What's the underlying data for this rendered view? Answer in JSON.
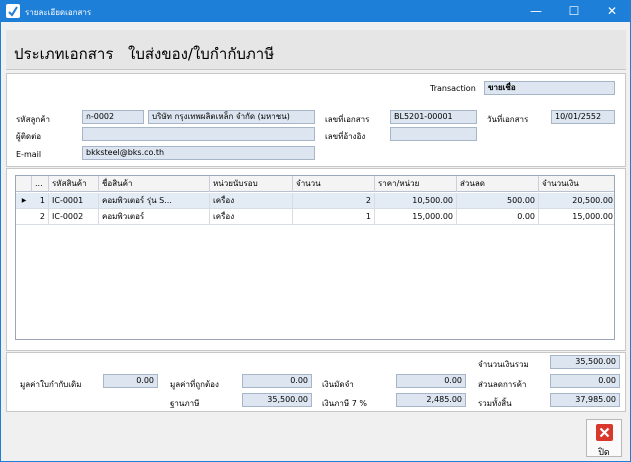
{
  "window": {
    "title": "รายละเอียดเอกสาร",
    "minimize_glyph": "—",
    "maximize_glyph": "☐",
    "close_glyph": "✕"
  },
  "header": {
    "label": "ประเภทเอกสาร",
    "doc_type": "ใบส่งของ/ใบกำกับภาษี"
  },
  "info": {
    "transaction_label": "Transaction",
    "transaction_value": "ขายเชื่อ",
    "customer_code_label": "รหัสลูกค้า",
    "customer_code": "ก-0002",
    "customer_name": "บริษัท กรุงเทพผลิตเหล็ก จำกัด (มหาชน)",
    "doc_no_label": "เลขที่เอกสาร",
    "doc_no": "BL5201-00001",
    "doc_date_label": "วันที่เอกสาร",
    "doc_date": "10/01/2552",
    "contact_label": "ผู้ติดต่อ",
    "contact": "",
    "ref_no_label": "เลขที่อ้างอิง",
    "ref_no": "",
    "email_label": "E-mail",
    "email": "bkksteel@bks.co.th"
  },
  "grid": {
    "columns": [
      "...",
      "รหัสสินค้า",
      "ชื่อสินค้า",
      "หน่วยนับรอบ",
      "จำนวน",
      "ราคา/หน่วย",
      "ส่วนลด",
      "จำนวนเงิน"
    ],
    "rows": [
      {
        "no": "1",
        "code": "IC-0001",
        "name": "คอมพิวเตอร์ รุ่น S...",
        "unit": "เครื่อง",
        "qty": "2",
        "price": "10,500.00",
        "discount": "500.00",
        "amount": "20,500.00"
      },
      {
        "no": "2",
        "code": "IC-0002",
        "name": "คอมพิวเตอร์",
        "unit": "เครื่อง",
        "qty": "1",
        "price": "15,000.00",
        "discount": "0.00",
        "amount": "15,000.00"
      }
    ]
  },
  "totals": {
    "total_amount_label": "จำนวนเงินรวม",
    "total_amount": "35,500.00",
    "orig_invoice_label": "มูลค่าใบกำกับเดิม",
    "orig_invoice": "0.00",
    "correct_value_label": "มูลค่าที่ถูกต้อง",
    "correct_value": "0.00",
    "deposit_label": "เงินมัดจำ",
    "deposit": "0.00",
    "trade_discount_label": "ส่วนลดการค้า",
    "trade_discount": "0.00",
    "tax_base_label": "ฐานภาษี",
    "tax_base": "35,500.00",
    "vat_label": "เงินภาษี 7 %",
    "vat": "2,485.00",
    "grand_total_label": "รวมทั้งสิ้น",
    "grand_total": "37,985.00"
  },
  "footer": {
    "close_label": "ปิด"
  },
  "colors": {
    "titlebar": "#1e7fd8",
    "field_bg": "#dde6f0",
    "close_red": "#d9372c"
  }
}
